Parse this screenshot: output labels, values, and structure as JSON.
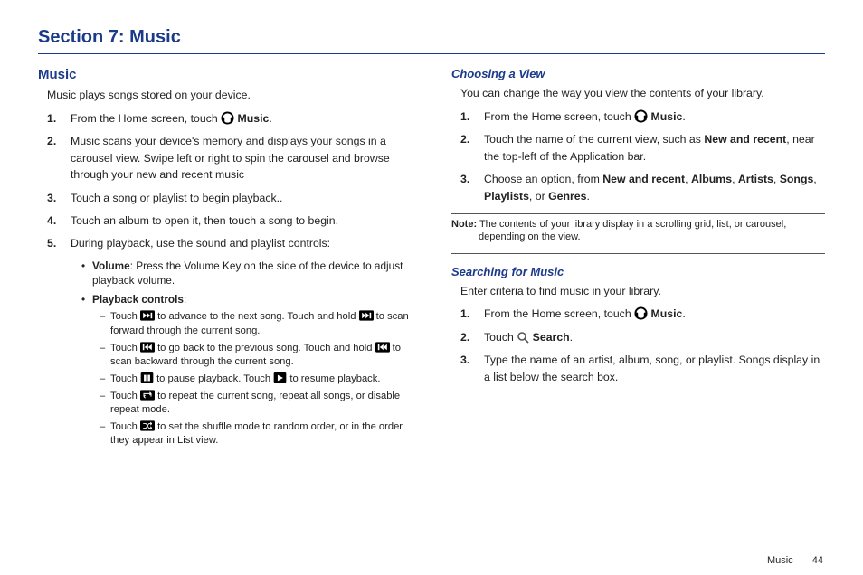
{
  "section_title": "Section 7: Music",
  "left": {
    "heading": "Music",
    "intro": "Music plays songs stored on your device.",
    "steps": {
      "s1a": "From the Home screen, touch ",
      "s1b": " Music",
      "s1c": ".",
      "s2": "Music scans your device's memory and displays your songs in a carousel view. Swipe left or right to spin the carousel and browse through your new and recent music",
      "s3": "Touch a song or playlist to begin playback..",
      "s4": "Touch an album to open it, then touch a song to begin.",
      "s5": "During playback, use the sound and playlist controls:"
    },
    "bullets": {
      "vol_label": "Volume",
      "vol_text": ": Press the Volume Key on the side of the device to adjust playback volume.",
      "pc_label": "Playback controls",
      "pc_colon": ":"
    },
    "dashes": {
      "d1a": "Touch ",
      "d1b": " to advance to the next song. Touch and hold ",
      "d1c": " to scan forward through the current song.",
      "d2a": "Touch ",
      "d2b": " to go back to the previous song. Touch and hold ",
      "d2c": " to scan backward through the current song.",
      "d3a": "Touch ",
      "d3b": " to pause playback. Touch ",
      "d3c": " to resume playback.",
      "d4a": "Touch ",
      "d4b": " to repeat the current song, repeat all songs, or disable repeat mode.",
      "d5a": "Touch ",
      "d5b": " to set the shuffle mode to random order, or in the order they appear in List view."
    }
  },
  "right": {
    "view_heading": "Choosing a View",
    "view_intro": "You can change the way you view the contents of your library.",
    "view_steps": {
      "s1a": "From the Home screen, touch ",
      "s1b": " Music",
      "s1c": ".",
      "s2a": "Touch the name of the current view, such as ",
      "s2b": "New and recent",
      "s2c": ", near the top-left of the Application bar.",
      "s3a": "Choose an option, from ",
      "s3b": "New and recent",
      "s3c": ", ",
      "s3d": "Albums",
      "s3e": ", ",
      "s3f": "Artists",
      "s3g": ", ",
      "s3h": "Songs",
      "s3i": ", ",
      "s3j": "Playlists",
      "s3k": ", or ",
      "s3l": "Genres",
      "s3m": "."
    },
    "note_label": "Note:",
    "note_text": " The contents of your library display in a scrolling grid, list, or carousel, depending on the view.",
    "search_heading": "Searching for Music",
    "search_intro": "Enter criteria to find music in your library.",
    "search_steps": {
      "s1a": "From the Home screen, touch ",
      "s1b": " Music",
      "s1c": ".",
      "s2a": "Touch ",
      "s2b": " Search",
      "s2c": ".",
      "s3": "Type the name of an artist, album, song, or playlist. Songs display in a list below the search box."
    }
  },
  "footer": {
    "label": "Music",
    "page": "44"
  }
}
